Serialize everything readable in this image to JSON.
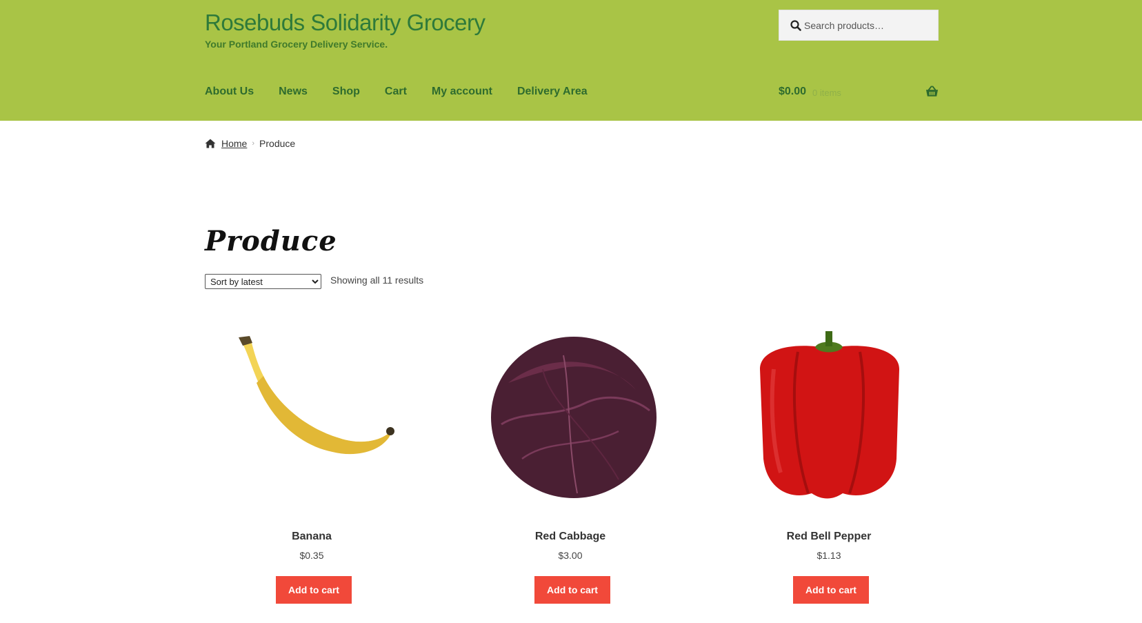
{
  "header": {
    "site_title": "Rosebuds Solidarity Grocery",
    "tagline": "Your Portland Grocery Delivery Service.",
    "search_placeholder": "Search products…",
    "nav": [
      "About Us",
      "News",
      "Shop",
      "Cart",
      "My account",
      "Delivery Area"
    ],
    "cart_amount": "$0.00",
    "cart_count": "0 items"
  },
  "breadcrumb": {
    "home": "Home",
    "current": "Produce"
  },
  "main": {
    "title": "Produce",
    "sort_selected": "Sort by latest",
    "result_count": "Showing all 11 results",
    "products": [
      {
        "name": "Banana",
        "price": "$0.35",
        "button": "Add to cart",
        "image": "banana"
      },
      {
        "name": "Red Cabbage",
        "price": "$3.00",
        "button": "Add to cart",
        "image": "red-cabbage"
      },
      {
        "name": "Red Bell Pepper",
        "price": "$1.13",
        "button": "Add to cart",
        "image": "red-bell-pepper"
      }
    ]
  },
  "colors": {
    "header_bg": "#a9c446",
    "button_bg": "#f1493a",
    "nav_text": "#2e6b2e"
  }
}
